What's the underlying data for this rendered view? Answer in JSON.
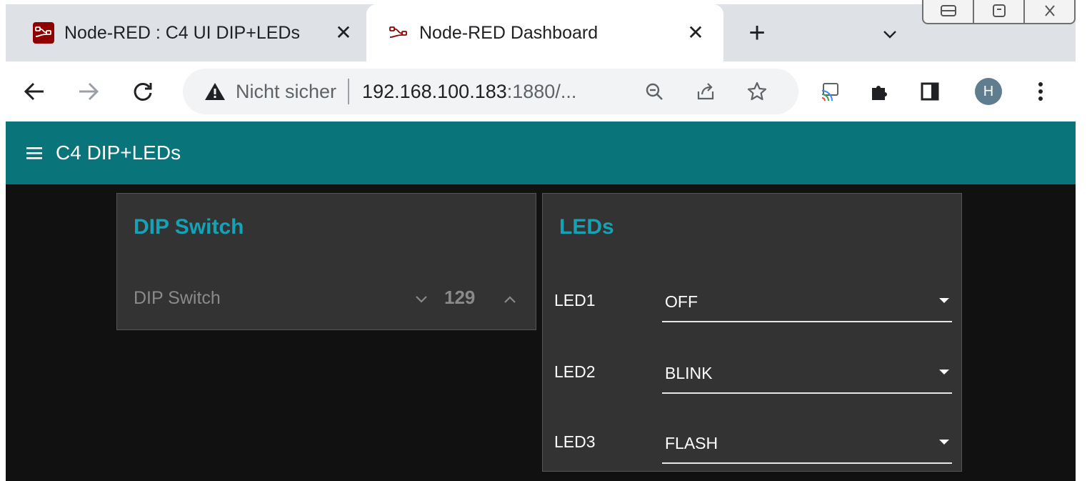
{
  "browser": {
    "tabs": [
      {
        "title": "Node-RED : C4 UI DIP+LEDs",
        "icon": "node-red-icon",
        "active": false
      },
      {
        "title": "Node-RED Dashboard",
        "icon": "node-red-icon",
        "active": true
      }
    ],
    "tab_close_glyph": "✕",
    "new_tab_glyph": "+",
    "omnibox": {
      "security_text": "Nicht sicher",
      "host": "192.168.100.183",
      "rest": ":1880/..."
    },
    "profile_initial": "H"
  },
  "dashboard": {
    "title": "C4 DIP+LEDs",
    "header_color": "#097479",
    "accent_color": "#12a3b6",
    "groups": {
      "dip": {
        "title": "DIP Switch",
        "numeric": {
          "label": "DIP Switch",
          "value": "129"
        }
      },
      "leds": {
        "title": "LEDs",
        "rows": [
          {
            "label": "LED1",
            "value": "OFF"
          },
          {
            "label": "LED2",
            "value": "BLINK"
          },
          {
            "label": "LED3",
            "value": "FLASH"
          }
        ]
      }
    }
  }
}
